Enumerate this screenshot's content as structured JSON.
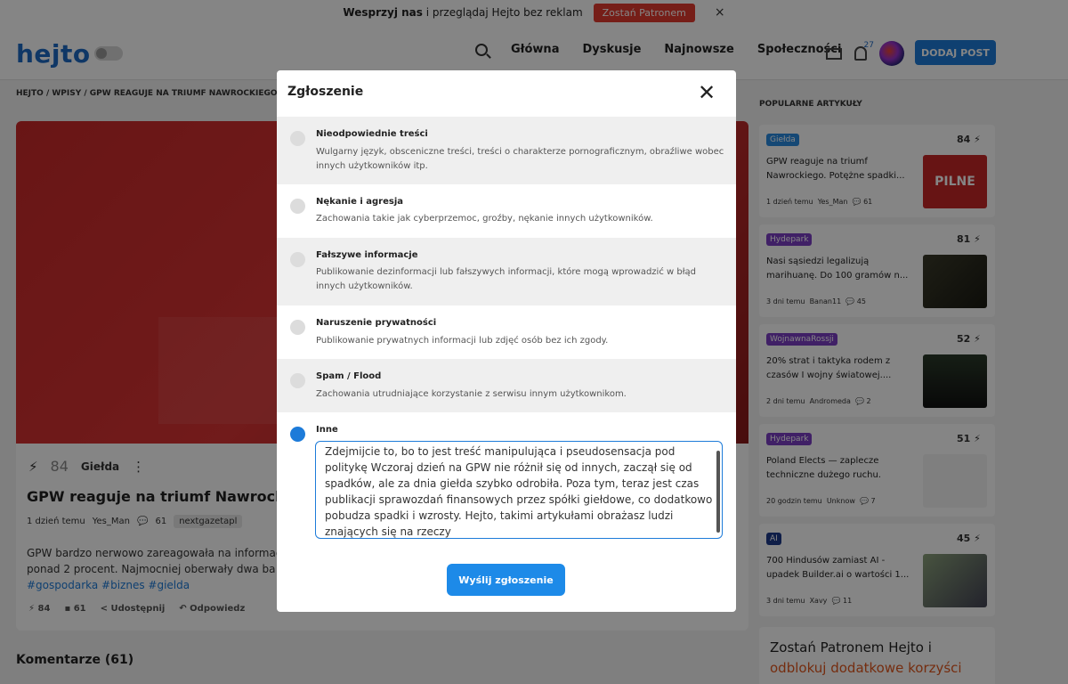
{
  "promo": {
    "bold_text": "Wesprzyj nas",
    "text": "i przeglądaj Hejto bez reklam",
    "button": "Zostań Patronem",
    "close": "×"
  },
  "header": {
    "logo": "hejto",
    "nav": [
      "Główna",
      "Dyskusje",
      "Najnowsze",
      "Społeczności"
    ],
    "notifications_count": "27",
    "add_post": "DODAJ POST"
  },
  "breadcrumb": "HEJTO / WPISY / GPW REAGUJE NA TRIUMF NAWROCKIEGO.",
  "article": {
    "score": "84",
    "category": "Giełda",
    "title": "GPW reaguje na triumf Nawrockiego",
    "time": "1 dzień temu",
    "author": "Yes_Man",
    "comments": "61",
    "tag": "nextgazetapl",
    "body_line1": "GPW bardzo nerwowo zareagowała na informac",
    "body_line2": "ponad 2 procent. Najmocniej oberwały dwa ba",
    "hashtags": "#gospodarka #biznes #gielda",
    "actions": {
      "score": "84",
      "comments": "61",
      "share": "Udostępnij",
      "reply": "Odpowiedz"
    }
  },
  "comments_heading": "Komentarze (61)",
  "sidebar": {
    "heading": "POPULARNE ARTYKUŁY",
    "cards": [
      {
        "category": "Giełda",
        "cat_color": "#2a8ae0",
        "score": "84",
        "title": "GPW reaguje na triumf Nawrockiego. Potężne spadki...",
        "time": "1 dzień temu",
        "author": "Yes_Man",
        "comments": "61",
        "thumb": "PILNE"
      },
      {
        "category": "Hydepark",
        "cat_color": "#7b3fc4",
        "score": "81",
        "title": "Nasi sąsiedzi legalizują marihuanę. Do 100 gramów n...",
        "time": "3 dni temu",
        "author": "Banan11",
        "comments": "45"
      },
      {
        "category": "WojnawnaRossji",
        "cat_color": "#7b3fc4",
        "score": "52",
        "title": "20% strat i taktyka rodem z czasów I wojny światowej....",
        "time": "2 dni temu",
        "author": "Andromeda",
        "comments": "2"
      },
      {
        "category": "Hydepark",
        "cat_color": "#7b3fc4",
        "score": "51",
        "title": "Poland Elects — zaplecze techniczne dużego ruchu.",
        "time": "20 godzin temu",
        "author": "Unknow",
        "comments": "7"
      },
      {
        "category": "AI",
        "cat_color": "#1e3a8a",
        "score": "45",
        "title": "700 Hindusów zamiast AI - upadek Builder.ai o wartości 1...",
        "time": "3 dni temu",
        "author": "Xavy",
        "comments": "11"
      }
    ],
    "patron_line1": "Zostań Patronem Hejto i",
    "patron_line2": "odblokuj dodatkowe korzyści"
  },
  "modal": {
    "title": "Zgłoszenie",
    "close": "✕",
    "options": [
      {
        "title": "Nieodpowiednie treści",
        "desc": "Wulgarny język, obsceniczne treści, treści o charakterze pornograficznym, obraźliwe wobec innych użytkowników itp."
      },
      {
        "title": "Nękanie i agresja",
        "desc": "Zachowania takie jak cyberprzemoc, groźby, nękanie innych użytkowników."
      },
      {
        "title": "Fałszywe informacje",
        "desc": "Publikowanie dezinformacji lub fałszywych informacji, które mogą wprowadzić w błąd innych użytkowników."
      },
      {
        "title": "Naruszenie prywatności",
        "desc": "Publikowanie prywatnych informacji lub zdjęć osób bez ich zgody."
      },
      {
        "title": "Spam / Flood",
        "desc": "Zachowania utrudniające korzystanie z serwisu innym użytkownikom."
      },
      {
        "title": "Inne",
        "desc": ""
      }
    ],
    "selected_option": "Inne",
    "textarea_value": "Zdejmijcie to, bo to jest treść manipulująca i pseudosensacja pod politykę Wczoraj dzień na GPW nie różnił się od innych, zaczął się od spadków, ale za dnia giełda szybko odrobiła. Poza tym, teraz jest czas publikacji sprawozdań finansowych przez spółki giełdowe, co dodatkowo pobudza spadki i wzrosty. Hejto, takimi artykułami obrażasz ludzi znających się na rzeczy",
    "submit": "Wyślij zgłoszenie"
  }
}
